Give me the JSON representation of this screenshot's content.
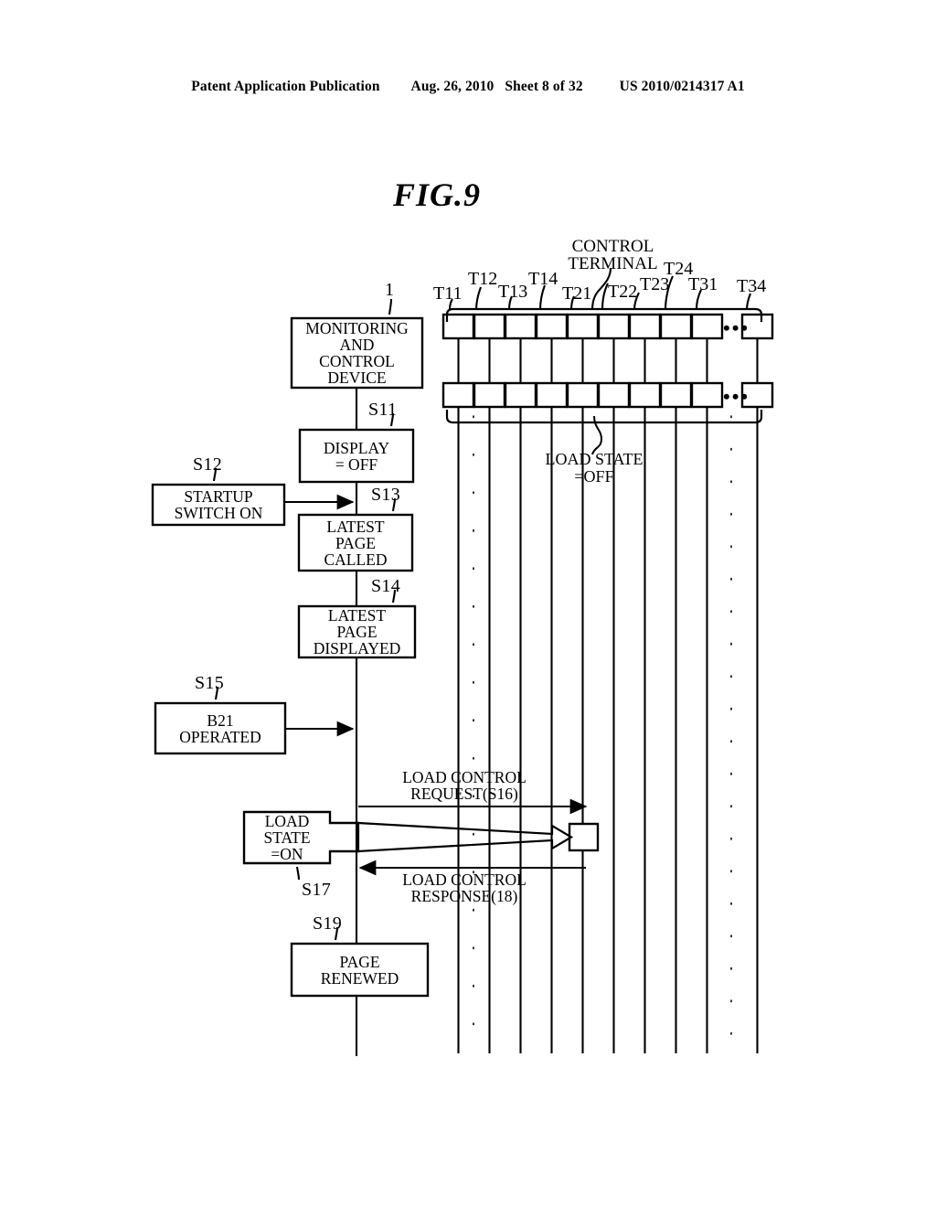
{
  "header": {
    "left": "Patent Application Publication",
    "date": "Aug. 26, 2010",
    "sheet": "Sheet 8 of 32",
    "patent_number": "US 2010/0214317 A1"
  },
  "figure": {
    "title": "FIG.9"
  },
  "device": {
    "ref_number": "1",
    "label": "MONITORING\nAND\nCONTROL\nDEVICE"
  },
  "steps": [
    {
      "id": "S11",
      "label": "DISPLAY\n= OFF"
    },
    {
      "id": "S12",
      "label": "STARTUP\nSWITCH ON"
    },
    {
      "id": "S13",
      "label": "LATEST\nPAGE\nCALLED"
    },
    {
      "id": "S14",
      "label": "LATEST\nPAGE\nDISPLAYED"
    },
    {
      "id": "S15",
      "label": "B21\nOPERATED"
    },
    {
      "id": "S17",
      "label": "LOAD\nSTATE\n=ON"
    },
    {
      "id": "S19",
      "label": "PAGE\nRENEWED"
    }
  ],
  "messages": [
    {
      "name": "request",
      "label": "LOAD CONTROL\nREQUEST(S16)"
    },
    {
      "name": "response",
      "label": "LOAD CONTROL\nRESPONSE(18)"
    }
  ],
  "terminal_bus": {
    "title": "CONTROL\nTERMINAL",
    "load_state_label": "LOAD STATE\n=OFF",
    "ellipsis": "•••",
    "terminals": [
      {
        "id": "T11"
      },
      {
        "id": "T12"
      },
      {
        "id": "T13"
      },
      {
        "id": "T14"
      },
      {
        "id": "T21"
      },
      {
        "id": "T22"
      },
      {
        "id": "T23"
      },
      {
        "id": "T24"
      },
      {
        "id": "T31"
      },
      {
        "id": "T34"
      }
    ]
  },
  "colors": {
    "ink": "#000000",
    "paper": "#ffffff"
  }
}
